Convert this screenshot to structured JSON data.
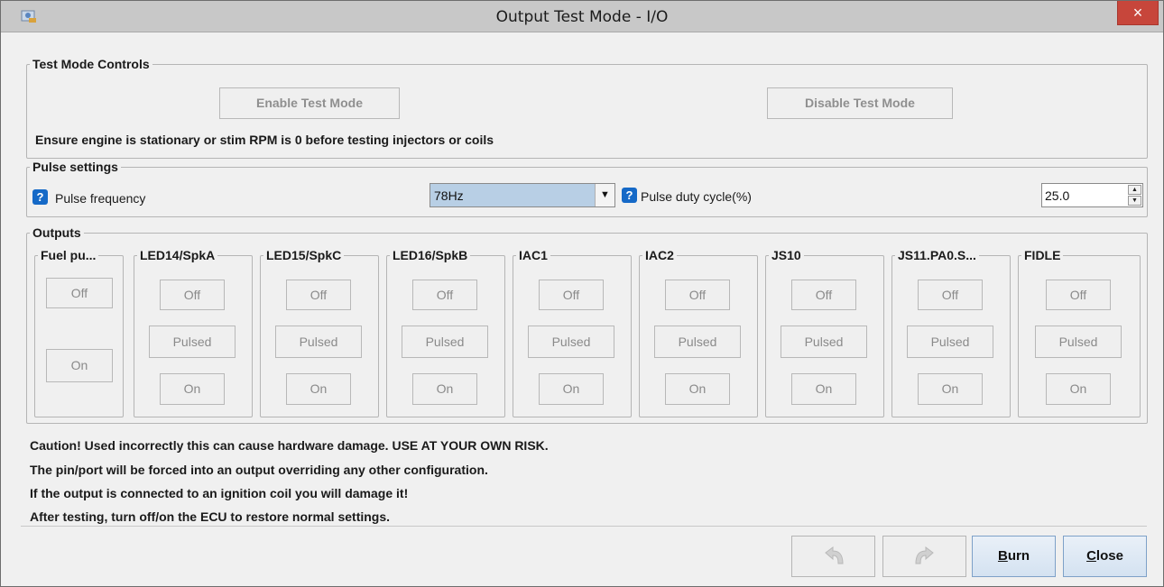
{
  "window": {
    "title": "Output Test Mode - I/O",
    "close_glyph": "×",
    "app_icon": "app-icon",
    "titlebar_color": "#c8c8c8",
    "close_color": "#c7463b"
  },
  "test_mode": {
    "legend": "Test Mode Controls",
    "enable_label": "Enable Test Mode",
    "disable_label": "Disable Test Mode",
    "warning": "Ensure engine is stationary or stim RPM is 0 before testing injectors or coils"
  },
  "pulse": {
    "legend": "Pulse settings",
    "help_glyph": "?",
    "frequency_label": "Pulse frequency",
    "frequency_value": "78Hz",
    "duty_label": "Pulse duty cycle(%)",
    "duty_value": "25.0",
    "accent": "#1569c7"
  },
  "outputs": {
    "legend": "Outputs",
    "groups": [
      {
        "name": "Fuel pu...",
        "off": "Off",
        "on": "On"
      },
      {
        "name": "LED14/SpkA",
        "off": "Off",
        "pulsed": "Pulsed",
        "on": "On"
      },
      {
        "name": "LED15/SpkC",
        "off": "Off",
        "pulsed": "Pulsed",
        "on": "On"
      },
      {
        "name": "LED16/SpkB",
        "off": "Off",
        "pulsed": "Pulsed",
        "on": "On"
      },
      {
        "name": "IAC1",
        "off": "Off",
        "pulsed": "Pulsed",
        "on": "On"
      },
      {
        "name": "IAC2",
        "off": "Off",
        "pulsed": "Pulsed",
        "on": "On"
      },
      {
        "name": "JS10",
        "off": "Off",
        "pulsed": "Pulsed",
        "on": "On"
      },
      {
        "name": "JS11.PA0.S...",
        "off": "Off",
        "pulsed": "Pulsed",
        "on": "On"
      },
      {
        "name": "FIDLE",
        "off": "Off",
        "pulsed": "Pulsed",
        "on": "On"
      }
    ]
  },
  "caution_lines": [
    "Caution! Used incorrectly this can cause hardware damage. USE AT YOUR OWN RISK.",
    "The pin/port will be forced into an output overriding any other configuration.",
    "If the output is connected to an ignition coil you will damage it!",
    "After testing, turn off/on the ECU to restore normal settings."
  ],
  "footer": {
    "undo_icon": "undo-icon",
    "redo_icon": "redo-icon",
    "burn_mnemonic": "B",
    "burn_rest": "urn",
    "close_mnemonic": "C",
    "close_rest": "lose"
  }
}
